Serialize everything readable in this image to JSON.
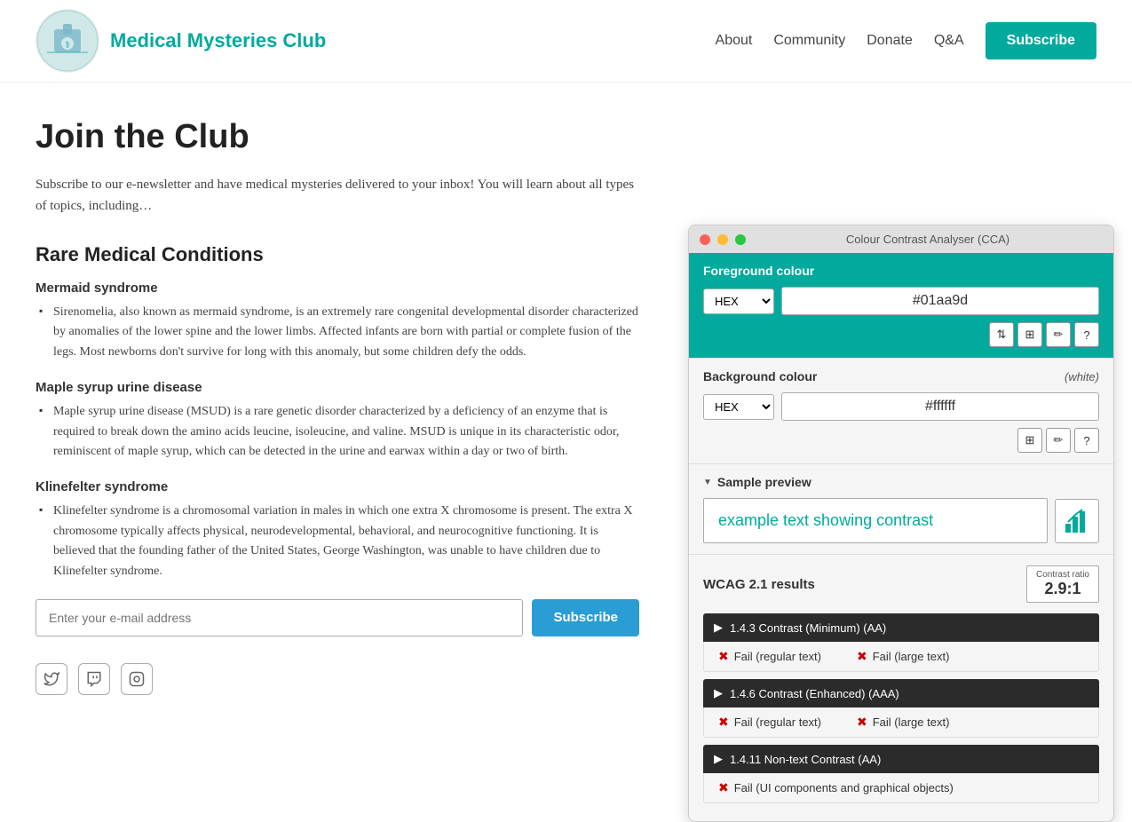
{
  "header": {
    "logo_title": "Medical Mysteries Club",
    "nav": {
      "about": "About",
      "community": "Community",
      "donate": "Donate",
      "qa": "Q&A",
      "subscribe": "Subscribe"
    }
  },
  "page": {
    "title": "Join the Club",
    "intro": "Subscribe to our e-newsletter and have medical mysteries delivered to your inbox! You will learn about all types of topics, including…",
    "conditions_title": "Rare Medical Conditions",
    "conditions": [
      {
        "name": "Mermaid syndrome",
        "desc": "Sirenomelia, also known as mermaid syndrome, is an extremely rare congenital developmental disorder characterized by anomalies of the lower spine and the lower limbs. Affected infants are born with partial or complete fusion of the legs. Most newborns don't survive for long with this anomaly, but some children defy the odds."
      },
      {
        "name": "Maple syrup urine disease",
        "desc": "Maple syrup urine disease (MSUD) is a rare genetic disorder characterized by a deficiency of an enzyme that is required to break down the amino acids leucine, isoleucine, and valine. MSUD is unique in its characteristic odor, reminiscent of maple syrup, which can be detected in the urine and earwax within a day or two of birth."
      },
      {
        "name": "Klinefelter syndrome",
        "desc": "Klinefelter syndrome is a chromosomal variation in males in which one extra X chromosome is present. The extra X chromosome typically affects physical, neurodevelopmental, behavioral, and neurocognitive functioning. It is believed that the founding father of the United States, George Washington, was unable to have children due to Klinefelter syndrome."
      }
    ],
    "email_placeholder": "Enter your e-mail address",
    "subscribe_btn": "Subscribe"
  },
  "cca": {
    "title": "Colour Contrast Analyser (CCA)",
    "fg_label": "Foreground colour",
    "fg_format": "HEX",
    "fg_value": "#01aa9d",
    "bg_label": "Background colour",
    "bg_white": "(white)",
    "bg_format": "HEX",
    "bg_value": "#ffffff",
    "preview_label": "Sample preview",
    "example_text": "example text showing contrast",
    "wcag_label": "WCAG 2.1 results",
    "contrast_ratio_label": "Contrast ratio",
    "contrast_ratio": "2.9:1",
    "criteria": [
      {
        "id": "1.4.3",
        "label": "1.4.3 Contrast (Minimum) (AA)",
        "fail_regular": "Fail (regular text)",
        "fail_large": "Fail (large text)"
      },
      {
        "id": "1.4.6",
        "label": "1.4.6 Contrast (Enhanced) (AAA)",
        "fail_regular": "Fail (regular text)",
        "fail_large": "Fail (large text)"
      },
      {
        "id": "1.4.11",
        "label": "1.4.11 Non-text Contrast (AA)",
        "fail_ui": "Fail (UI components and graphical objects)"
      }
    ]
  }
}
